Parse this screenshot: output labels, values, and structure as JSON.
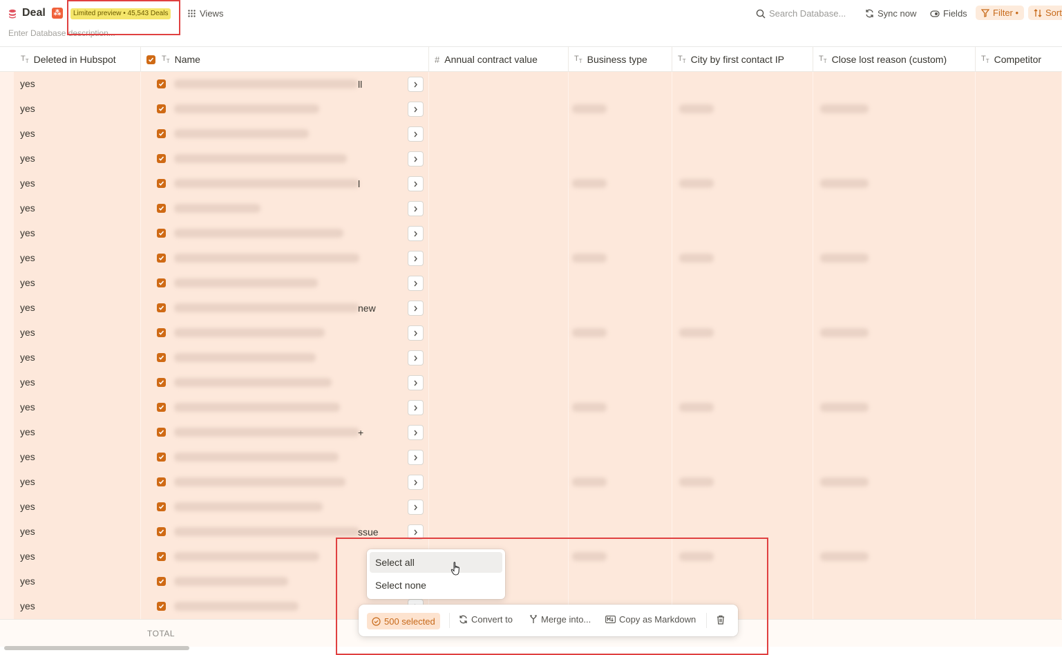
{
  "header": {
    "title": "Deal",
    "source_icon": "hubspot-icon",
    "preview_badge": "Limited preview • 45,543 Deals",
    "views_label": "Views",
    "description_placeholder": "Enter Database description...",
    "search_placeholder": "Search Database...",
    "sync_label": "Sync now",
    "fields_label": "Fields",
    "filter_label": "Filter •",
    "sort_label": "Sort"
  },
  "columns": [
    {
      "label": "Deleted in Hubspot",
      "icon": "text-type-icon"
    },
    {
      "label": "Name",
      "icon": "text-type-icon"
    },
    {
      "label": "Annual contract value",
      "icon": "number-type-icon"
    },
    {
      "label": "Business type",
      "icon": "text-type-icon"
    },
    {
      "label": "City by first contact IP",
      "icon": "text-type-icon"
    },
    {
      "label": "Close lost reason (custom)",
      "icon": "text-type-icon"
    },
    {
      "label": "Competitor",
      "icon": "text-type-icon"
    }
  ],
  "rows": [
    {
      "deleted": "yes",
      "name_fragment": "ll"
    },
    {
      "deleted": "yes",
      "name_fragment": ""
    },
    {
      "deleted": "yes",
      "name_fragment": ""
    },
    {
      "deleted": "yes",
      "name_fragment": ""
    },
    {
      "deleted": "yes",
      "name_fragment": "l"
    },
    {
      "deleted": "yes",
      "name_fragment": ""
    },
    {
      "deleted": "yes",
      "name_fragment": ""
    },
    {
      "deleted": "yes",
      "name_fragment": ""
    },
    {
      "deleted": "yes",
      "name_fragment": ""
    },
    {
      "deleted": "yes",
      "name_fragment": "new"
    },
    {
      "deleted": "yes",
      "name_fragment": ""
    },
    {
      "deleted": "yes",
      "name_fragment": ""
    },
    {
      "deleted": "yes",
      "name_fragment": ""
    },
    {
      "deleted": "yes",
      "name_fragment": ""
    },
    {
      "deleted": "yes",
      "name_fragment": "+"
    },
    {
      "deleted": "yes",
      "name_fragment": ""
    },
    {
      "deleted": "yes",
      "name_fragment": ""
    },
    {
      "deleted": "yes",
      "name_fragment": ""
    },
    {
      "deleted": "yes",
      "name_fragment": "ssue"
    },
    {
      "deleted": "yes",
      "name_fragment": ""
    },
    {
      "deleted": "yes",
      "name_fragment": ""
    },
    {
      "deleted": "yes",
      "name_fragment": ""
    }
  ],
  "footer": {
    "total_label": "TOTAL"
  },
  "select_menu": {
    "select_all": "Select all",
    "select_none": "Select none"
  },
  "action_bar": {
    "selected_label": "500 selected",
    "convert_label": "Convert to",
    "merge_label": "Merge into...",
    "copy_label": "Copy as Markdown"
  },
  "colors": {
    "accent": "#cf6a15",
    "row_highlight": "#fde8db",
    "annotation": "#e04040"
  }
}
